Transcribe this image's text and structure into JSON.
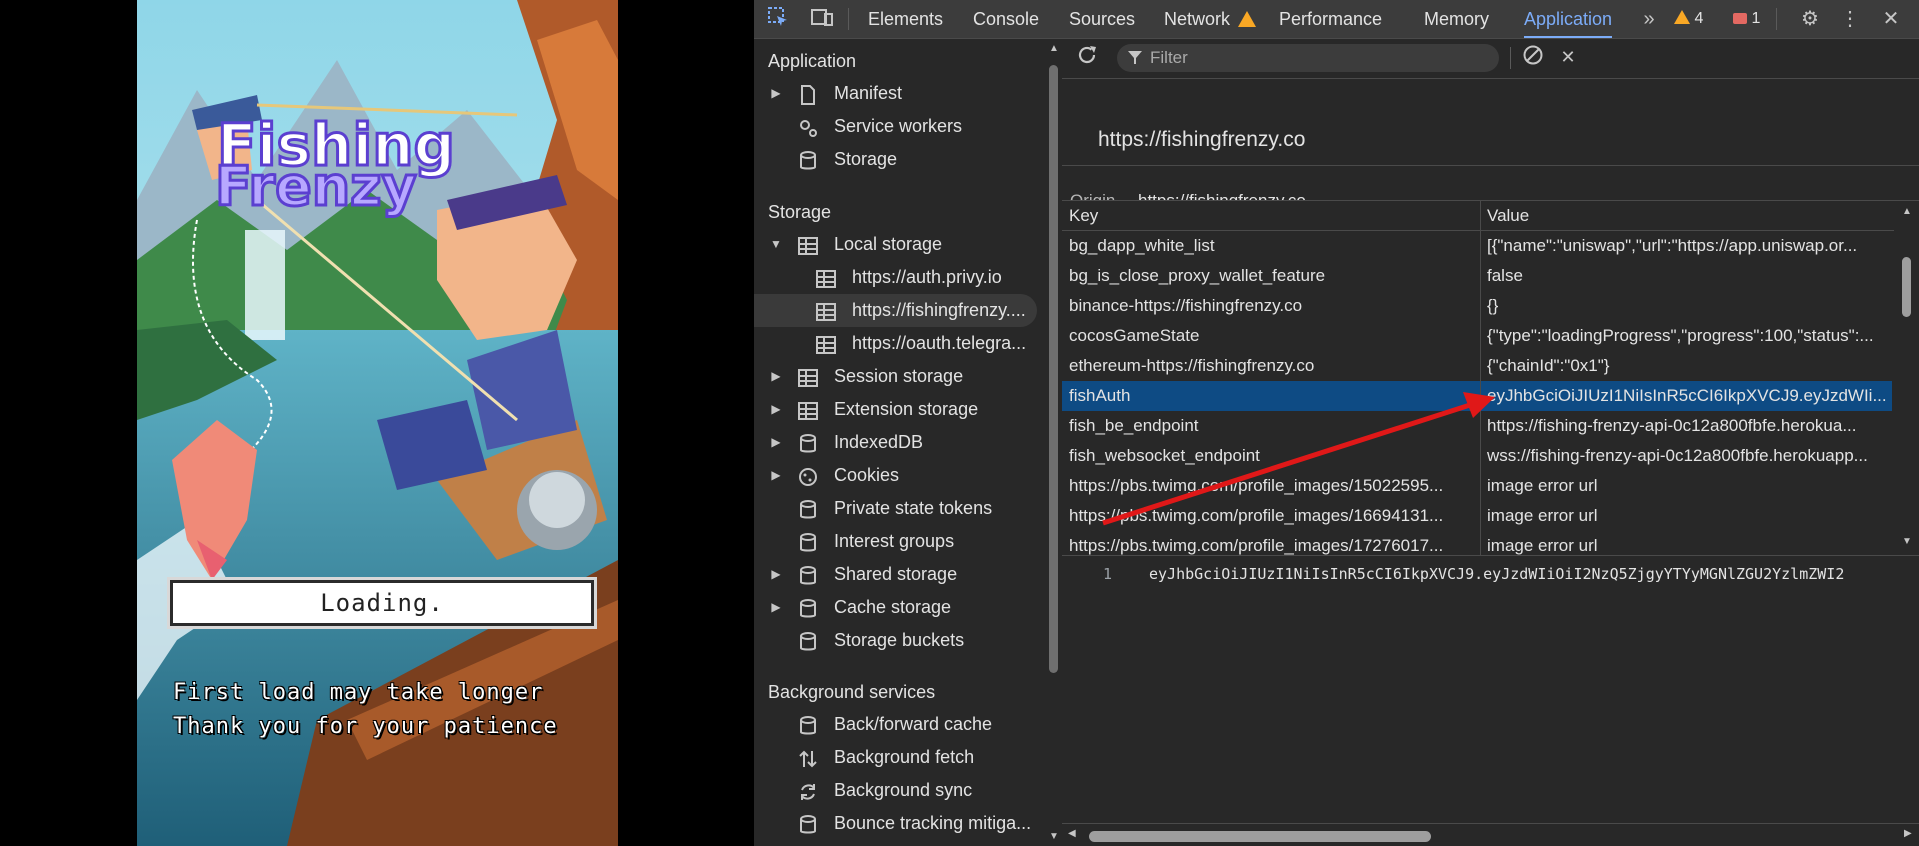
{
  "game": {
    "title_line1": "Fishing",
    "title_line2": "Frenzy",
    "loading_text": "Loading.",
    "message_line1": "First load may take longer",
    "message_line2": "Thank you for your patience"
  },
  "devtools": {
    "tabs": [
      "Elements",
      "Console",
      "Sources",
      "Network",
      "Performance",
      "Memory",
      "Application"
    ],
    "active_tab": "Application",
    "warning_count": "4",
    "error_count": "1",
    "filter_placeholder": "Filter",
    "sidebar": {
      "application_title": "Application",
      "application_items": [
        "Manifest",
        "Service workers",
        "Storage"
      ],
      "storage_title": "Storage",
      "local_storage_label": "Local storage",
      "local_storage_origins": [
        "https://auth.privy.io",
        "https://fishingfrenzy....",
        "https://oauth.telegra..."
      ],
      "storage_items": [
        "Session storage",
        "Extension storage",
        "IndexedDB",
        "Cookies",
        "Private state tokens",
        "Interest groups",
        "Shared storage",
        "Cache storage",
        "Storage buckets"
      ],
      "background_title": "Background services",
      "background_items": [
        "Back/forward cache",
        "Background fetch",
        "Background sync",
        "Bounce tracking mitiga..."
      ]
    },
    "storage_view": {
      "origin_heading": "https://fishingfrenzy.co",
      "origin_label": "Origin",
      "origin_value": "https://fishingfrenzy.co",
      "columns": [
        "Key",
        "Value"
      ],
      "rows": [
        {
          "key": "bg_dapp_white_list",
          "value": "[{\"name\":\"uniswap\",\"url\":\"https://app.uniswap.or..."
        },
        {
          "key": "bg_is_close_proxy_wallet_feature",
          "value": "false"
        },
        {
          "key": "binance-https://fishingfrenzy.co",
          "value": "{}"
        },
        {
          "key": "cocosGameState",
          "value": "{\"type\":\"loadingProgress\",\"progress\":100,\"status\":..."
        },
        {
          "key": "ethereum-https://fishingfrenzy.co",
          "value": "{\"chainId\":\"0x1\"}"
        },
        {
          "key": "fishAuth",
          "value": "eyJhbGciOiJIUzI1NiIsInR5cCI6IkpXVCJ9.eyJzdWIi..."
        },
        {
          "key": "fish_be_endpoint",
          "value": "https://fishing-frenzy-api-0c12a800fbfe.herokua..."
        },
        {
          "key": "fish_websocket_endpoint",
          "value": "wss://fishing-frenzy-api-0c12a800fbfe.herokuapp..."
        },
        {
          "key": "https://pbs.twimg.com/profile_images/15022595...",
          "value": "image error url"
        },
        {
          "key": "https://pbs.twimg.com/profile_images/16694131...",
          "value": "image error url"
        },
        {
          "key": "https://pbs.twimg.com/profile_images/17276017...",
          "value": "image error url"
        }
      ],
      "selected_row": 5,
      "preview_line_number": "1",
      "preview_value": "eyJhbGciOiJIUzI1NiIsInR5cCI6IkpXVCJ9.eyJzdWIiOiI2NzQ5ZjgyYTYyMGNlZGU2YzlmZWI2"
    }
  },
  "colors": {
    "devtools_bg": "#282828",
    "toolbar_bg": "#3c3c3c",
    "accent_blue": "#7cacf8",
    "selected_row": "#0e4b84",
    "warning": "#f9a825",
    "error": "#e46962",
    "annotation_arrow": "#e01818"
  }
}
